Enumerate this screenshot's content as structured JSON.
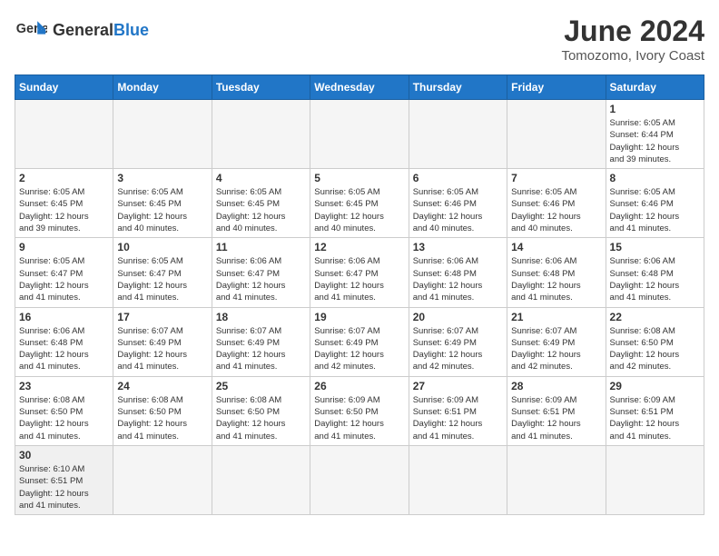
{
  "header": {
    "logo_general": "General",
    "logo_blue": "Blue",
    "month_title": "June 2024",
    "subtitle": "Tomozomo, Ivory Coast"
  },
  "days_of_week": [
    "Sunday",
    "Monday",
    "Tuesday",
    "Wednesday",
    "Thursday",
    "Friday",
    "Saturday"
  ],
  "weeks": [
    [
      {
        "day": "",
        "info": ""
      },
      {
        "day": "",
        "info": ""
      },
      {
        "day": "",
        "info": ""
      },
      {
        "day": "",
        "info": ""
      },
      {
        "day": "",
        "info": ""
      },
      {
        "day": "",
        "info": ""
      },
      {
        "day": "1",
        "info": "Sunrise: 6:05 AM\nSunset: 6:44 PM\nDaylight: 12 hours\nand 39 minutes."
      }
    ],
    [
      {
        "day": "2",
        "info": "Sunrise: 6:05 AM\nSunset: 6:45 PM\nDaylight: 12 hours\nand 39 minutes."
      },
      {
        "day": "3",
        "info": "Sunrise: 6:05 AM\nSunset: 6:45 PM\nDaylight: 12 hours\nand 40 minutes."
      },
      {
        "day": "4",
        "info": "Sunrise: 6:05 AM\nSunset: 6:45 PM\nDaylight: 12 hours\nand 40 minutes."
      },
      {
        "day": "5",
        "info": "Sunrise: 6:05 AM\nSunset: 6:45 PM\nDaylight: 12 hours\nand 40 minutes."
      },
      {
        "day": "6",
        "info": "Sunrise: 6:05 AM\nSunset: 6:46 PM\nDaylight: 12 hours\nand 40 minutes."
      },
      {
        "day": "7",
        "info": "Sunrise: 6:05 AM\nSunset: 6:46 PM\nDaylight: 12 hours\nand 40 minutes."
      },
      {
        "day": "8",
        "info": "Sunrise: 6:05 AM\nSunset: 6:46 PM\nDaylight: 12 hours\nand 41 minutes."
      }
    ],
    [
      {
        "day": "9",
        "info": "Sunrise: 6:05 AM\nSunset: 6:47 PM\nDaylight: 12 hours\nand 41 minutes."
      },
      {
        "day": "10",
        "info": "Sunrise: 6:05 AM\nSunset: 6:47 PM\nDaylight: 12 hours\nand 41 minutes."
      },
      {
        "day": "11",
        "info": "Sunrise: 6:06 AM\nSunset: 6:47 PM\nDaylight: 12 hours\nand 41 minutes."
      },
      {
        "day": "12",
        "info": "Sunrise: 6:06 AM\nSunset: 6:47 PM\nDaylight: 12 hours\nand 41 minutes."
      },
      {
        "day": "13",
        "info": "Sunrise: 6:06 AM\nSunset: 6:48 PM\nDaylight: 12 hours\nand 41 minutes."
      },
      {
        "day": "14",
        "info": "Sunrise: 6:06 AM\nSunset: 6:48 PM\nDaylight: 12 hours\nand 41 minutes."
      },
      {
        "day": "15",
        "info": "Sunrise: 6:06 AM\nSunset: 6:48 PM\nDaylight: 12 hours\nand 41 minutes."
      }
    ],
    [
      {
        "day": "16",
        "info": "Sunrise: 6:06 AM\nSunset: 6:48 PM\nDaylight: 12 hours\nand 41 minutes."
      },
      {
        "day": "17",
        "info": "Sunrise: 6:07 AM\nSunset: 6:49 PM\nDaylight: 12 hours\nand 41 minutes."
      },
      {
        "day": "18",
        "info": "Sunrise: 6:07 AM\nSunset: 6:49 PM\nDaylight: 12 hours\nand 41 minutes."
      },
      {
        "day": "19",
        "info": "Sunrise: 6:07 AM\nSunset: 6:49 PM\nDaylight: 12 hours\nand 42 minutes."
      },
      {
        "day": "20",
        "info": "Sunrise: 6:07 AM\nSunset: 6:49 PM\nDaylight: 12 hours\nand 42 minutes."
      },
      {
        "day": "21",
        "info": "Sunrise: 6:07 AM\nSunset: 6:49 PM\nDaylight: 12 hours\nand 42 minutes."
      },
      {
        "day": "22",
        "info": "Sunrise: 6:08 AM\nSunset: 6:50 PM\nDaylight: 12 hours\nand 42 minutes."
      }
    ],
    [
      {
        "day": "23",
        "info": "Sunrise: 6:08 AM\nSunset: 6:50 PM\nDaylight: 12 hours\nand 41 minutes."
      },
      {
        "day": "24",
        "info": "Sunrise: 6:08 AM\nSunset: 6:50 PM\nDaylight: 12 hours\nand 41 minutes."
      },
      {
        "day": "25",
        "info": "Sunrise: 6:08 AM\nSunset: 6:50 PM\nDaylight: 12 hours\nand 41 minutes."
      },
      {
        "day": "26",
        "info": "Sunrise: 6:09 AM\nSunset: 6:50 PM\nDaylight: 12 hours\nand 41 minutes."
      },
      {
        "day": "27",
        "info": "Sunrise: 6:09 AM\nSunset: 6:51 PM\nDaylight: 12 hours\nand 41 minutes."
      },
      {
        "day": "28",
        "info": "Sunrise: 6:09 AM\nSunset: 6:51 PM\nDaylight: 12 hours\nand 41 minutes."
      },
      {
        "day": "29",
        "info": "Sunrise: 6:09 AM\nSunset: 6:51 PM\nDaylight: 12 hours\nand 41 minutes."
      }
    ],
    [
      {
        "day": "30",
        "info": "Sunrise: 6:10 AM\nSunset: 6:51 PM\nDaylight: 12 hours\nand 41 minutes."
      },
      {
        "day": "",
        "info": ""
      },
      {
        "day": "",
        "info": ""
      },
      {
        "day": "",
        "info": ""
      },
      {
        "day": "",
        "info": ""
      },
      {
        "day": "",
        "info": ""
      },
      {
        "day": "",
        "info": ""
      }
    ]
  ]
}
